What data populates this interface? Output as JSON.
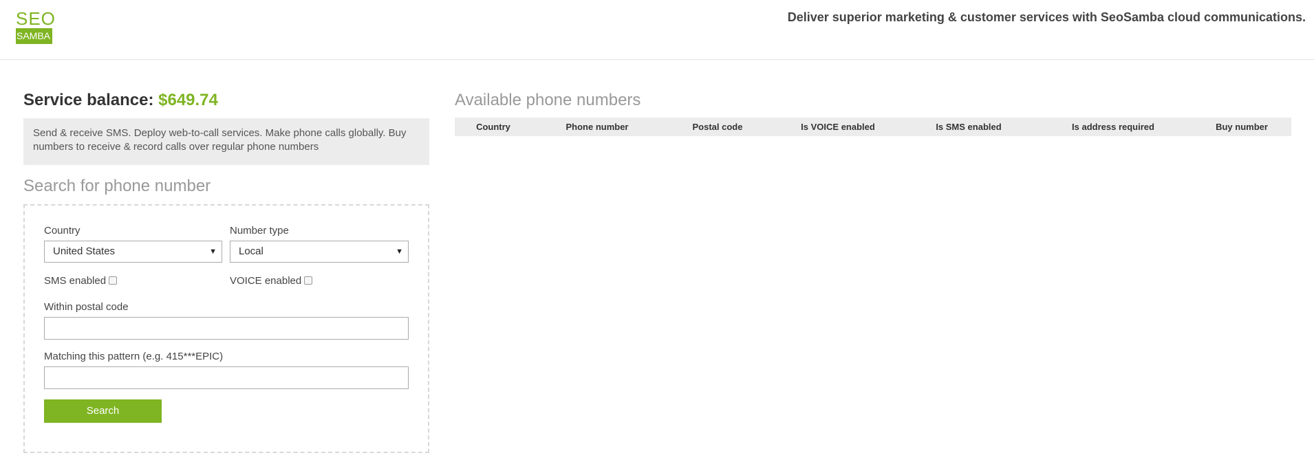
{
  "header": {
    "logo_top": "SEO",
    "logo_bottom": "SAMBA",
    "tagline": "Deliver superior marketing & customer services with SeoSamba cloud communications."
  },
  "balance": {
    "label": "Service balance: ",
    "value": "$649.74"
  },
  "description": "Send & receive SMS. Deploy web-to-call services. Make phone calls globally. Buy numbers to receive & record calls over regular phone numbers",
  "search": {
    "title": "Search for phone number",
    "country_label": "Country",
    "country_value": "United States",
    "number_type_label": "Number type",
    "number_type_value": "Local",
    "sms_label": "SMS enabled",
    "voice_label": "VOICE enabled",
    "postal_label": "Within postal code",
    "postal_value": "",
    "pattern_label": "Matching this pattern (e.g. 415***EPIC)",
    "pattern_value": "",
    "button": "Search"
  },
  "results": {
    "title": "Available phone numbers",
    "columns": [
      "Country",
      "Phone number",
      "Postal code",
      "Is VOICE enabled",
      "Is SMS enabled",
      "Is address required",
      "Buy number"
    ]
  },
  "colors": {
    "brand": "#7fb422",
    "panel_bg": "#ececec"
  },
  "icons": {
    "dropdown": "caret-down-icon"
  }
}
